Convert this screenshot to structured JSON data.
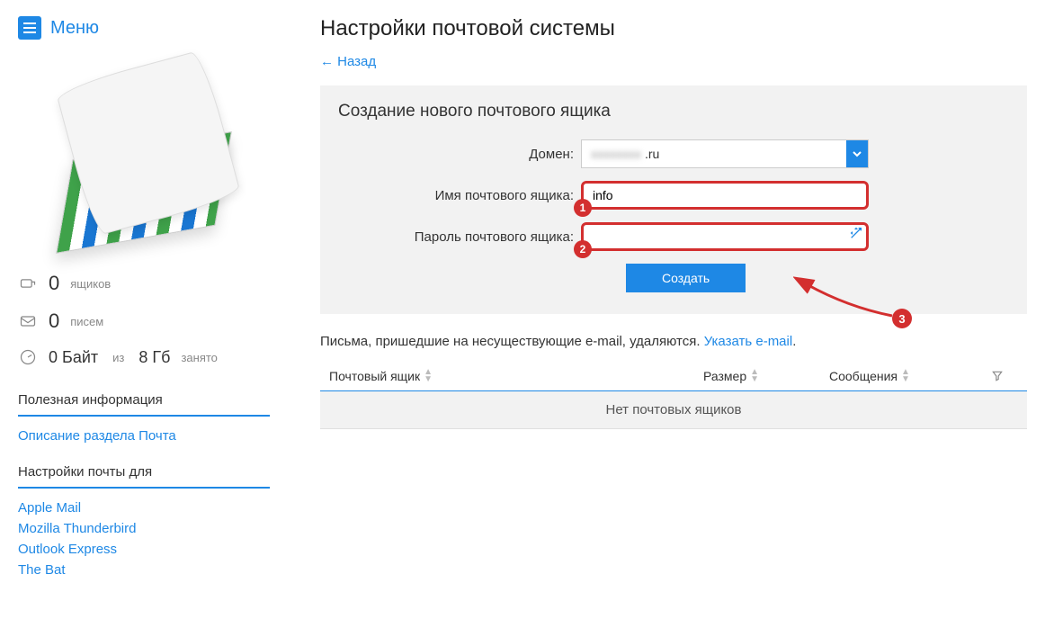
{
  "sidebar": {
    "menu_label": "Меню",
    "stats": {
      "mailboxes_count": "0",
      "mailboxes_label": "ящиков",
      "letters_count": "0",
      "letters_label": "писем",
      "storage_used": "0 Байт",
      "storage_mid": "из",
      "storage_total": "8 Гб",
      "storage_suffix": "занято"
    },
    "sections": {
      "useful_title": "Полезная информация",
      "useful_links": [
        "Описание раздела Почта"
      ],
      "settings_title": "Настройки почты для",
      "settings_links": [
        "Apple Mail",
        "Mozilla Thunderbird",
        "Outlook Express",
        "The Bat"
      ]
    }
  },
  "main": {
    "title": "Настройки почтовой системы",
    "back": "← Назад",
    "panel": {
      "title": "Создание нового почтового ящика",
      "domain_label": "Домен:",
      "domain_value_suffix": ".ru",
      "name_label": "Имя почтового ящика:",
      "name_value": "info",
      "password_label": "Пароль почтового ящика:",
      "password_value": "",
      "submit": "Создать"
    },
    "annotations": {
      "b1": "1",
      "b2": "2",
      "b3": "3"
    },
    "info": {
      "text": "Письма, пришедшие на несуществующие e-mail, удаляются. ",
      "link": "Указать e-mail",
      "period": "."
    },
    "table": {
      "col_mailbox": "Почтовый ящик",
      "col_size": "Размер",
      "col_msgs": "Сообщения",
      "empty": "Нет почтовых ящиков"
    }
  }
}
